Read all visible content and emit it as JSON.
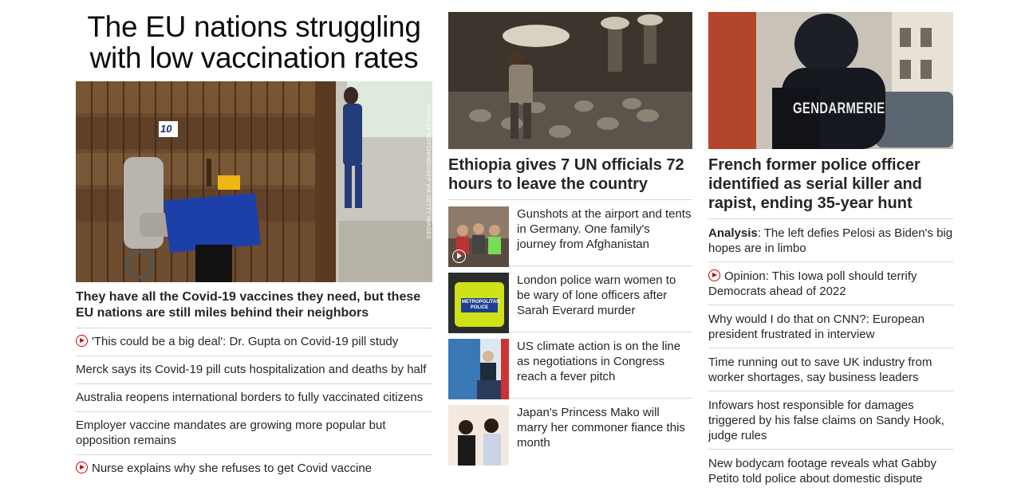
{
  "col1": {
    "headline": "The EU nations struggling with low vaccination rates",
    "image_credit": "NIKOLAY DOYCHINOV/AFP VIA GETTY IMAGES",
    "image_sign": "10",
    "subheadline": "They have all the Covid-19 vaccines they need, but these EU nations are still miles behind their neighbors",
    "items": [
      {
        "text": "'This could be a big deal': Dr. Gupta on Covid-19 pill study",
        "video": true
      },
      {
        "text": "Merck says its Covid-19 pill cuts hospitalization and deaths by half",
        "video": false
      },
      {
        "text": "Australia reopens international borders to fully vaccinated citizens",
        "video": false
      },
      {
        "text": "Employer vaccine mandates are growing more popular but opposition remains",
        "video": false
      },
      {
        "text": "Nurse explains why she refuses to get Covid vaccine",
        "video": true
      }
    ]
  },
  "col2": {
    "headline": "Ethiopia gives 7 UN officials 72 hours to leave the country",
    "items": [
      {
        "text": "Gunshots at the airport and tents in Germany. One family's journey from Afghanistan",
        "video": true,
        "thumb": "family"
      },
      {
        "text": "London police warn women to be wary of lone officers after Sarah Everard murder",
        "video": false,
        "thumb": "police",
        "thumb_text": "METROPOLITAN POLICE"
      },
      {
        "text": "US climate action is on the line as negotiations in Congress reach a fever pitch",
        "video": false,
        "thumb": "podium"
      },
      {
        "text": "Japan's Princess Mako will marry her commoner fiance this month",
        "video": false,
        "thumb": "couple"
      }
    ]
  },
  "col3": {
    "headline": "French former police officer identified as serial killer and rapist, ending 35-year hunt",
    "image_label": "GENDARMERIE",
    "items": [
      {
        "prefix": "Analysis",
        "text": ": The left defies Pelosi as Biden's big hopes are in limbo",
        "video": false
      },
      {
        "prefix": "",
        "text": "Opinion: This Iowa poll should terrify Democrats ahead of 2022",
        "video": true
      },
      {
        "prefix": "",
        "text": "Why would I do that on CNN?: European president frustrated in interview",
        "video": false
      },
      {
        "prefix": "",
        "text": "Time running out to save UK industry from worker shortages, say business leaders",
        "video": false
      },
      {
        "prefix": "",
        "text": "Infowars host responsible for damages triggered by his false claims on Sandy Hook, judge rules",
        "video": false
      },
      {
        "prefix": "",
        "text": "New bodycam footage reveals what Gabby Petito told police about domestic dispute",
        "video": false
      }
    ]
  },
  "colors": {
    "accent_red": "#cc0000",
    "divider": "#d6d6d6",
    "text": "#262626"
  }
}
